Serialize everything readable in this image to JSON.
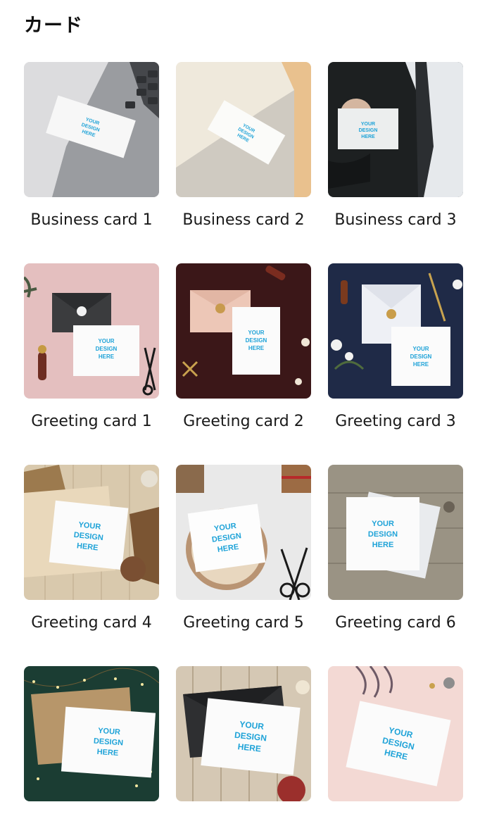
{
  "section_title": "カード",
  "placeholder_text": [
    "YOUR",
    "DESIGN",
    "HERE"
  ],
  "colors": {
    "placeholder_text": "#1fa3d8"
  },
  "cards": [
    {
      "label": "Business card 1"
    },
    {
      "label": "Business card 2"
    },
    {
      "label": "Business card 3"
    },
    {
      "label": "Greeting card 1"
    },
    {
      "label": "Greeting card 2"
    },
    {
      "label": "Greeting card 3"
    },
    {
      "label": "Greeting card 4"
    },
    {
      "label": "Greeting card 5"
    },
    {
      "label": "Greeting card 6"
    }
  ]
}
